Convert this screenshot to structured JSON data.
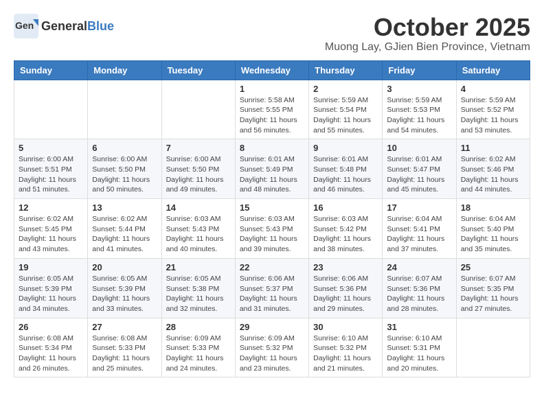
{
  "header": {
    "logo_general": "General",
    "logo_blue": "Blue",
    "month_title": "October 2025",
    "location": "Muong Lay, GJien Bien Province, Vietnam"
  },
  "days_of_week": [
    "Sunday",
    "Monday",
    "Tuesday",
    "Wednesday",
    "Thursday",
    "Friday",
    "Saturday"
  ],
  "weeks": [
    [
      {
        "day": "",
        "info": ""
      },
      {
        "day": "",
        "info": ""
      },
      {
        "day": "",
        "info": ""
      },
      {
        "day": "1",
        "info": "Sunrise: 5:58 AM\nSunset: 5:55 PM\nDaylight: 11 hours and 56 minutes."
      },
      {
        "day": "2",
        "info": "Sunrise: 5:59 AM\nSunset: 5:54 PM\nDaylight: 11 hours and 55 minutes."
      },
      {
        "day": "3",
        "info": "Sunrise: 5:59 AM\nSunset: 5:53 PM\nDaylight: 11 hours and 54 minutes."
      },
      {
        "day": "4",
        "info": "Sunrise: 5:59 AM\nSunset: 5:52 PM\nDaylight: 11 hours and 53 minutes."
      }
    ],
    [
      {
        "day": "5",
        "info": "Sunrise: 6:00 AM\nSunset: 5:51 PM\nDaylight: 11 hours and 51 minutes."
      },
      {
        "day": "6",
        "info": "Sunrise: 6:00 AM\nSunset: 5:50 PM\nDaylight: 11 hours and 50 minutes."
      },
      {
        "day": "7",
        "info": "Sunrise: 6:00 AM\nSunset: 5:50 PM\nDaylight: 11 hours and 49 minutes."
      },
      {
        "day": "8",
        "info": "Sunrise: 6:01 AM\nSunset: 5:49 PM\nDaylight: 11 hours and 48 minutes."
      },
      {
        "day": "9",
        "info": "Sunrise: 6:01 AM\nSunset: 5:48 PM\nDaylight: 11 hours and 46 minutes."
      },
      {
        "day": "10",
        "info": "Sunrise: 6:01 AM\nSunset: 5:47 PM\nDaylight: 11 hours and 45 minutes."
      },
      {
        "day": "11",
        "info": "Sunrise: 6:02 AM\nSunset: 5:46 PM\nDaylight: 11 hours and 44 minutes."
      }
    ],
    [
      {
        "day": "12",
        "info": "Sunrise: 6:02 AM\nSunset: 5:45 PM\nDaylight: 11 hours and 43 minutes."
      },
      {
        "day": "13",
        "info": "Sunrise: 6:02 AM\nSunset: 5:44 PM\nDaylight: 11 hours and 41 minutes."
      },
      {
        "day": "14",
        "info": "Sunrise: 6:03 AM\nSunset: 5:43 PM\nDaylight: 11 hours and 40 minutes."
      },
      {
        "day": "15",
        "info": "Sunrise: 6:03 AM\nSunset: 5:43 PM\nDaylight: 11 hours and 39 minutes."
      },
      {
        "day": "16",
        "info": "Sunrise: 6:03 AM\nSunset: 5:42 PM\nDaylight: 11 hours and 38 minutes."
      },
      {
        "day": "17",
        "info": "Sunrise: 6:04 AM\nSunset: 5:41 PM\nDaylight: 11 hours and 37 minutes."
      },
      {
        "day": "18",
        "info": "Sunrise: 6:04 AM\nSunset: 5:40 PM\nDaylight: 11 hours and 35 minutes."
      }
    ],
    [
      {
        "day": "19",
        "info": "Sunrise: 6:05 AM\nSunset: 5:39 PM\nDaylight: 11 hours and 34 minutes."
      },
      {
        "day": "20",
        "info": "Sunrise: 6:05 AM\nSunset: 5:39 PM\nDaylight: 11 hours and 33 minutes."
      },
      {
        "day": "21",
        "info": "Sunrise: 6:05 AM\nSunset: 5:38 PM\nDaylight: 11 hours and 32 minutes."
      },
      {
        "day": "22",
        "info": "Sunrise: 6:06 AM\nSunset: 5:37 PM\nDaylight: 11 hours and 31 minutes."
      },
      {
        "day": "23",
        "info": "Sunrise: 6:06 AM\nSunset: 5:36 PM\nDaylight: 11 hours and 29 minutes."
      },
      {
        "day": "24",
        "info": "Sunrise: 6:07 AM\nSunset: 5:36 PM\nDaylight: 11 hours and 28 minutes."
      },
      {
        "day": "25",
        "info": "Sunrise: 6:07 AM\nSunset: 5:35 PM\nDaylight: 11 hours and 27 minutes."
      }
    ],
    [
      {
        "day": "26",
        "info": "Sunrise: 6:08 AM\nSunset: 5:34 PM\nDaylight: 11 hours and 26 minutes."
      },
      {
        "day": "27",
        "info": "Sunrise: 6:08 AM\nSunset: 5:33 PM\nDaylight: 11 hours and 25 minutes."
      },
      {
        "day": "28",
        "info": "Sunrise: 6:09 AM\nSunset: 5:33 PM\nDaylight: 11 hours and 24 minutes."
      },
      {
        "day": "29",
        "info": "Sunrise: 6:09 AM\nSunset: 5:32 PM\nDaylight: 11 hours and 23 minutes."
      },
      {
        "day": "30",
        "info": "Sunrise: 6:10 AM\nSunset: 5:32 PM\nDaylight: 11 hours and 21 minutes."
      },
      {
        "day": "31",
        "info": "Sunrise: 6:10 AM\nSunset: 5:31 PM\nDaylight: 11 hours and 20 minutes."
      },
      {
        "day": "",
        "info": ""
      }
    ]
  ]
}
